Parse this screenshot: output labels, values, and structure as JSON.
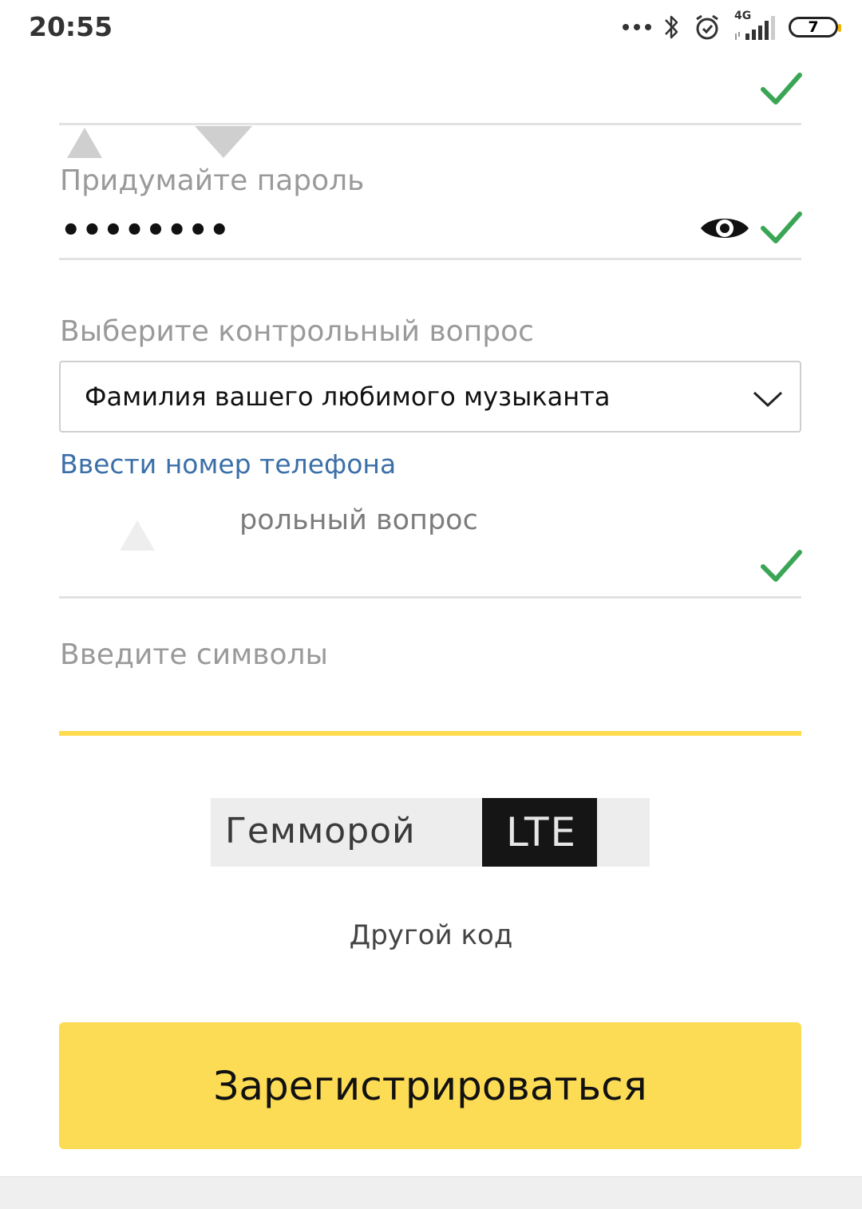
{
  "status_bar": {
    "time": "20:55",
    "network_label": "4G",
    "battery_level": "7",
    "icons": [
      "more-dots-icon",
      "bluetooth-icon",
      "alarm-icon",
      "signal-icon",
      "battery-icon"
    ]
  },
  "form": {
    "password": {
      "label": "Придумайте пароль",
      "value": "••••••••",
      "valid": true
    },
    "security_question": {
      "label": "Выберите контрольный вопрос",
      "selected": "Фамилия вашего любимого музыканта"
    },
    "phone_link": "Ввести номер телефона",
    "answer": {
      "label_partial": "рольный вопрос",
      "valid": true
    },
    "captcha": {
      "label": "Введите символы",
      "value": "",
      "image_word": "Геммoрой",
      "image_dark_text": "LTE"
    },
    "other_code": "Другой код",
    "submit_label": "Зарегистрироваться"
  },
  "colors": {
    "accent_yellow": "#fddc55",
    "check_green": "#3aa655",
    "link_blue": "#3b6fa8",
    "label_gray": "#9a9a9a"
  }
}
